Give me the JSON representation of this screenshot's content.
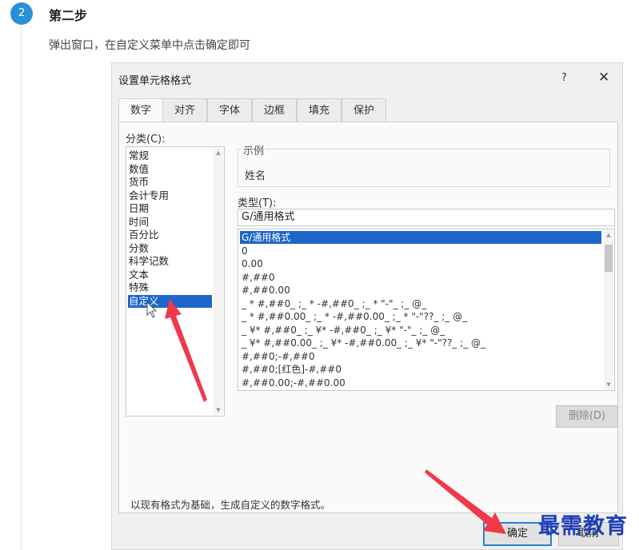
{
  "step": {
    "number": "2",
    "title": "第二步",
    "description": "弹出窗口，在自定义菜单中点击确定即可"
  },
  "dialog": {
    "title": "设置单元格格式",
    "help": "?",
    "close": "✕",
    "tabs": [
      {
        "label": "数字",
        "active": true
      },
      {
        "label": "对齐",
        "active": false
      },
      {
        "label": "字体",
        "active": false
      },
      {
        "label": "边框",
        "active": false
      },
      {
        "label": "填充",
        "active": false
      },
      {
        "label": "保护",
        "active": false
      }
    ],
    "category_label": "分类(C):",
    "categories": [
      "常规",
      "数值",
      "货币",
      "会计专用",
      "日期",
      "时间",
      "百分比",
      "分数",
      "科学记数",
      "文本",
      "特殊",
      "自定义"
    ],
    "selected_category": "自定义",
    "sample_label": "示例",
    "sample_value": "姓名",
    "type_label": "类型(T):",
    "type_input_value": "G/通用格式",
    "formats": [
      "G/通用格式",
      "0",
      "0.00",
      "#,##0",
      "#,##0.00",
      "_ * #,##0_ ;_ * -#,##0_ ;_ * \"-\"_ ;_ @_",
      "_ * #,##0.00_ ;_ * -#,##0.00_ ;_ * \"-\"??_ ;_ @_",
      "_ ¥* #,##0_ ;_ ¥* -#,##0_ ;_ ¥* \"-\"_ ;_ @_",
      "_ ¥* #,##0.00_ ;_ ¥* -#,##0.00_ ;_ ¥* \"-\"??_ ;_ @_",
      "#,##0;-#,##0",
      "#,##0;[红色]-#,##0",
      "#,##0.00;-#,##0.00"
    ],
    "selected_format": "G/通用格式",
    "delete_button": "删除(D)",
    "hint": "以现有格式为基础，生成自定义的数字格式。",
    "ok_button": "确定",
    "cancel_button": "取消"
  },
  "watermark": "最需教育",
  "colors": {
    "step_circle": "#2a8fd6",
    "selection": "#1e66c8",
    "arrow": "#f0394a",
    "watermark": "#1f3fb5"
  }
}
